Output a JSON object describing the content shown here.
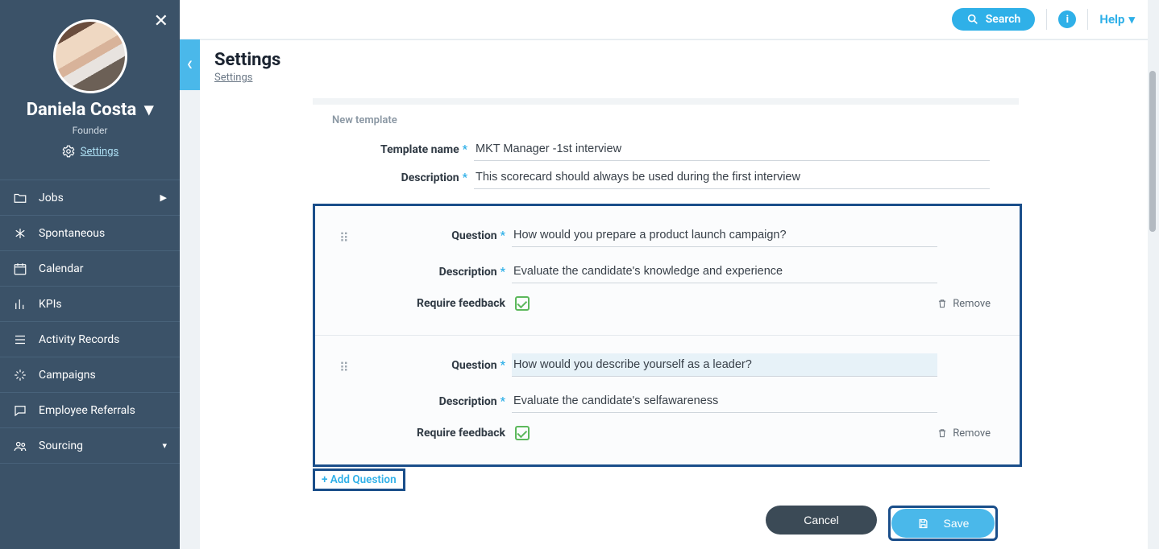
{
  "sidebar": {
    "user_name": "Daniela Costa",
    "user_role": "Founder",
    "user_settings_label": "Settings",
    "items": [
      {
        "key": "jobs",
        "label": "Jobs",
        "has_arrow": true
      },
      {
        "key": "spontaneous",
        "label": "Spontaneous"
      },
      {
        "key": "calendar",
        "label": "Calendar"
      },
      {
        "key": "kpis",
        "label": "KPIs"
      },
      {
        "key": "activity",
        "label": "Activity Records"
      },
      {
        "key": "campaigns",
        "label": "Campaigns"
      },
      {
        "key": "referrals",
        "label": "Employee Referrals"
      },
      {
        "key": "sourcing",
        "label": "Sourcing",
        "has_dropdown": true
      }
    ]
  },
  "topbar": {
    "search_label": "Search",
    "help_label": "Help"
  },
  "header": {
    "title": "Settings",
    "breadcrumb": "Settings"
  },
  "form": {
    "section_caption": "New template",
    "template_name_label": "Template name",
    "template_name_value": "MKT Manager -1st interview",
    "description_label": "Description",
    "description_value": "This scorecard should always be used during the first interview",
    "question_label": "Question",
    "q_description_label": "Description",
    "require_feedback_label": "Require feedback",
    "remove_label": "Remove",
    "questions": [
      {
        "text": "How would you prepare a product launch campaign?",
        "description": "Evaluate the candidate's knowledge and experience",
        "require_feedback": true
      },
      {
        "text": "How would you describe yourself as a leader?",
        "description": "Evaluate the candidate's selfawareness",
        "require_feedback": true,
        "highlight": true
      }
    ],
    "add_question_label": "+ Add Question",
    "cancel_label": "Cancel",
    "save_label": "Save"
  }
}
